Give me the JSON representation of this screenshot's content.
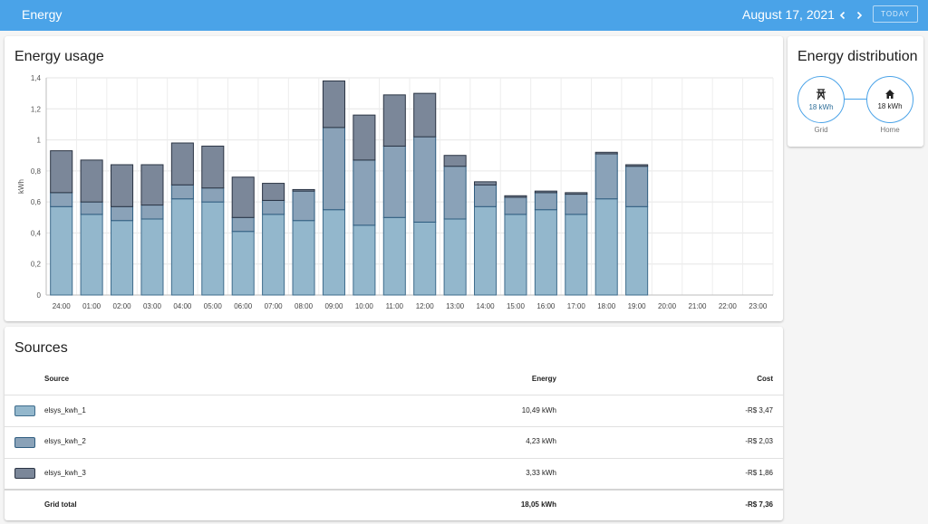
{
  "topbar": {
    "title": "Energy",
    "date": "August 17, 2021",
    "today_label": "TODAY"
  },
  "colors": {
    "primary": "#4aa3e8",
    "series1_fill": "#93b7cc",
    "series1_stroke": "#3f6c8c",
    "series2_fill": "#8aa2b8",
    "series2_stroke": "#2f5d80",
    "series3_fill": "#7b8799",
    "series3_stroke": "#2b3444"
  },
  "usage": {
    "title": "Energy usage"
  },
  "chart_data": {
    "type": "bar",
    "stacked": true,
    "ylabel": "kWh",
    "ylim": [
      0,
      1.4
    ],
    "ytick_labels": [
      "0",
      "0,2",
      "0,4",
      "0,6",
      "0,8",
      "1",
      "1,2",
      "1,4"
    ],
    "ytick_values": [
      0,
      0.2,
      0.4,
      0.6,
      0.8,
      1.0,
      1.2,
      1.4
    ],
    "grid": true,
    "legend": "none",
    "categories": [
      "24:00",
      "01:00",
      "02:00",
      "03:00",
      "04:00",
      "05:00",
      "06:00",
      "07:00",
      "08:00",
      "09:00",
      "10:00",
      "11:00",
      "12:00",
      "13:00",
      "14:00",
      "15:00",
      "16:00",
      "17:00",
      "18:00",
      "19:00",
      "20:00",
      "21:00",
      "22:00",
      "23:00"
    ],
    "series": [
      {
        "name": "elsys_kwh_1",
        "values": [
          0.57,
          0.52,
          0.48,
          0.49,
          0.62,
          0.6,
          0.41,
          0.52,
          0.48,
          0.55,
          0.45,
          0.5,
          0.47,
          0.49,
          0.57,
          0.52,
          0.55,
          0.52,
          0.62,
          0.57,
          0,
          0,
          0,
          0
        ]
      },
      {
        "name": "elsys_kwh_2",
        "values": [
          0.09,
          0.08,
          0.09,
          0.09,
          0.09,
          0.09,
          0.09,
          0.09,
          0.19,
          0.53,
          0.42,
          0.46,
          0.55,
          0.34,
          0.14,
          0.11,
          0.11,
          0.13,
          0.29,
          0.26,
          0,
          0,
          0,
          0
        ]
      },
      {
        "name": "elsys_kwh_3",
        "values": [
          0.27,
          0.27,
          0.27,
          0.26,
          0.27,
          0.27,
          0.26,
          0.11,
          0.01,
          0.3,
          0.29,
          0.33,
          0.28,
          0.07,
          0.02,
          0.01,
          0.01,
          0.01,
          0.01,
          0.01,
          0,
          0,
          0,
          0
        ]
      }
    ]
  },
  "distribution": {
    "title": "Energy distribution",
    "grid": {
      "value": "18 kWh",
      "label": "Grid",
      "icon": "transmission-tower-icon"
    },
    "home": {
      "value": "18 kWh",
      "label": "Home",
      "icon": "home-icon"
    }
  },
  "sources": {
    "title": "Sources",
    "headers": {
      "source": "Source",
      "energy": "Energy",
      "cost": "Cost"
    },
    "rows": [
      {
        "name": "elsys_kwh_1",
        "energy": "10,49 kWh",
        "cost": "-R$ 3,47"
      },
      {
        "name": "elsys_kwh_2",
        "energy": "4,23 kWh",
        "cost": "-R$ 2,03"
      },
      {
        "name": "elsys_kwh_3",
        "energy": "3,33 kWh",
        "cost": "-R$ 1,86"
      }
    ],
    "total": {
      "name": "Grid total",
      "energy": "18,05 kWh",
      "cost": "-R$ 7,36"
    }
  }
}
